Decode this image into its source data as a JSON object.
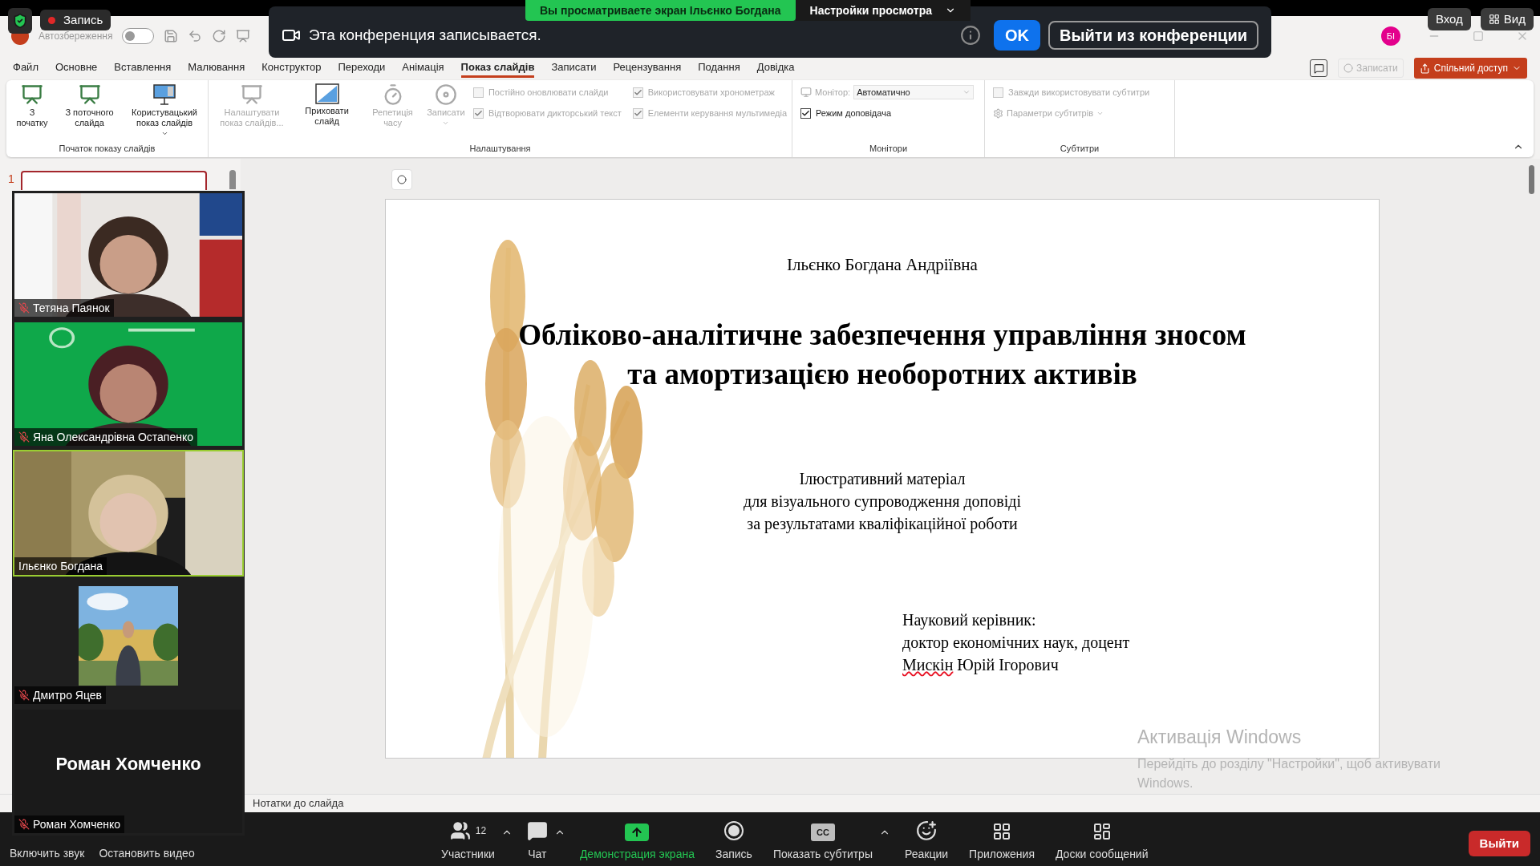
{
  "zoom_banner": {
    "sharing_label": "Вы просматриваете экран Ільєнко Богдана",
    "view_options": "Настройки просмотра"
  },
  "recording_notice": {
    "message": "Эта конференция записывается.",
    "ok_button": "OK",
    "leave_button": "Выйти из конференции"
  },
  "recording_indicator": {
    "label": "Запись"
  },
  "zoom_top_buttons": [
    {
      "kind": "signin",
      "label": "Вход"
    },
    {
      "kind": "view",
      "label": "Вид"
    }
  ],
  "title_bar": {
    "autosave_label": "Автозбереження",
    "autosave_on": false,
    "account_initials": "БІ"
  },
  "menu_tabs": [
    {
      "label": "Файл",
      "selected": false
    },
    {
      "label": "Основне",
      "selected": false
    },
    {
      "label": "Вставлення",
      "selected": false
    },
    {
      "label": "Малювання",
      "selected": false
    },
    {
      "label": "Конструктор",
      "selected": false
    },
    {
      "label": "Переходи",
      "selected": false
    },
    {
      "label": "Анімація",
      "selected": false
    },
    {
      "label": "Показ слайдів",
      "selected": true
    },
    {
      "label": "Записати",
      "selected": false
    },
    {
      "label": "Рецензування",
      "selected": false
    },
    {
      "label": "Подання",
      "selected": false
    },
    {
      "label": "Довідка",
      "selected": false
    }
  ],
  "menu_actions": {
    "record_label": "Записати",
    "share_label": "Спільний доступ"
  },
  "ribbon_groups": [
    {
      "title": "Початок показу слайдів",
      "controls": [
        {
          "kind": "big_button",
          "label": "З початку",
          "disabled": false,
          "dropdown": false
        },
        {
          "kind": "big_button",
          "label": "З поточного слайда",
          "disabled": false,
          "dropdown": false
        },
        {
          "kind": "big_button",
          "label": "Користувацький показ слайдів",
          "disabled": false,
          "dropdown": true
        }
      ]
    },
    {
      "title": "Налаштування",
      "controls": [
        {
          "kind": "big_button",
          "label": "Налаштувати показ слайдів...",
          "disabled": true,
          "dropdown": false
        },
        {
          "kind": "big_button",
          "label": "Приховати слайд",
          "disabled": false,
          "dropdown": false
        },
        {
          "kind": "big_button",
          "label": "Репетиція часу",
          "disabled": true,
          "dropdown": false
        },
        {
          "kind": "big_button",
          "label": "Записати",
          "disabled": true,
          "dropdown": true
        },
        {
          "kind": "checkbox",
          "label": "Постійно оновлювати слайди",
          "checked": false,
          "disabled": true
        },
        {
          "kind": "checkbox",
          "label": "Відтворювати дикторський текст",
          "checked": true,
          "disabled": true
        },
        {
          "kind": "checkbox",
          "label": "Використовувати хронометраж",
          "checked": true,
          "disabled": true
        },
        {
          "kind": "checkbox",
          "label": "Елементи керування мультимедіа",
          "checked": true,
          "disabled": true
        }
      ]
    },
    {
      "title": "Монітори",
      "controls": [
        {
          "kind": "select",
          "label": "Монітор:",
          "value": "Автоматично",
          "disabled": true
        },
        {
          "kind": "checkbox",
          "label": "Режим доповідача",
          "checked": true,
          "disabled": false
        }
      ]
    },
    {
      "title": "Субтитри",
      "controls": [
        {
          "kind": "checkbox",
          "label": "Завжди використовувати субтитри",
          "checked": false,
          "disabled": true
        },
        {
          "kind": "small_button",
          "label": "Параметри субтитрів",
          "disabled": true,
          "dropdown": true
        }
      ]
    }
  ],
  "slide_panel": {
    "slide_number": "1",
    "selected": true
  },
  "slide": {
    "author": "Ільєнко Богдана Андріївна",
    "title_lines": [
      "Обліково-аналітичне забезпечення управління зносом",
      "та амортизацією необоротних активів"
    ],
    "subtitle_lines": [
      "Ілюстративний матеріал",
      "для візуального супроводження доповіді",
      "за результатами кваліфікаційної роботи"
    ],
    "supervisor_lines": [
      [
        {
          "text": "Науковий керівник:",
          "misspelled": false
        }
      ],
      [
        {
          "text": "доктор економічних наук, доцент",
          "misspelled": false
        }
      ],
      [
        {
          "text": "Мискін",
          "misspelled": true
        },
        {
          "text": " Юрій Ігорович",
          "misspelled": false
        }
      ]
    ]
  },
  "participants": [
    {
      "name": "Тетяна Паянок",
      "muted": true,
      "kind": "camera",
      "active": false
    },
    {
      "name": "Яна Олександрівна Остапенко",
      "muted": true,
      "kind": "camera",
      "active": false
    },
    {
      "name": "Ільєнко Богдана",
      "muted": false,
      "kind": "camera",
      "active": true
    },
    {
      "name": "Дмитро Яцев",
      "muted": true,
      "kind": "camera_small",
      "active": false
    },
    {
      "name": "Роман Хомченко",
      "display_name": "Роман Хомченко",
      "muted": true,
      "kind": "no_video",
      "active": false
    }
  ],
  "notes_label": "Нотатки до слайда",
  "windows_activation": {
    "title": "Активація Windows",
    "message": "Перейдіть до розділу \"Настройки\", щоб активувати Windows."
  },
  "audio_video_labels": [
    "Включить звук",
    "Остановить видео"
  ],
  "toolbar": [
    {
      "kind": "participants",
      "label": "Участники",
      "count": "12",
      "menu_caret": true,
      "highlighted": false
    },
    {
      "kind": "chat",
      "label": "Чат",
      "menu_caret": true,
      "highlighted": false
    },
    {
      "kind": "share_screen",
      "label": "Демонстрация экрана",
      "menu_caret": false,
      "highlighted": true
    },
    {
      "kind": "record",
      "label": "Запись",
      "menu_caret": false,
      "highlighted": false
    },
    {
      "kind": "captions",
      "label": "Показать субтитры",
      "icon_text": "CC",
      "menu_caret": true,
      "highlighted": false
    },
    {
      "kind": "reactions",
      "label": "Реакции",
      "menu_caret": false,
      "highlighted": false
    },
    {
      "kind": "apps",
      "label": "Приложения",
      "menu_caret": false,
      "highlighted": false
    },
    {
      "kind": "whiteboards",
      "label": "Доски сообщений",
      "menu_caret": false,
      "highlighted": false
    }
  ],
  "leave_button": "Выйти"
}
